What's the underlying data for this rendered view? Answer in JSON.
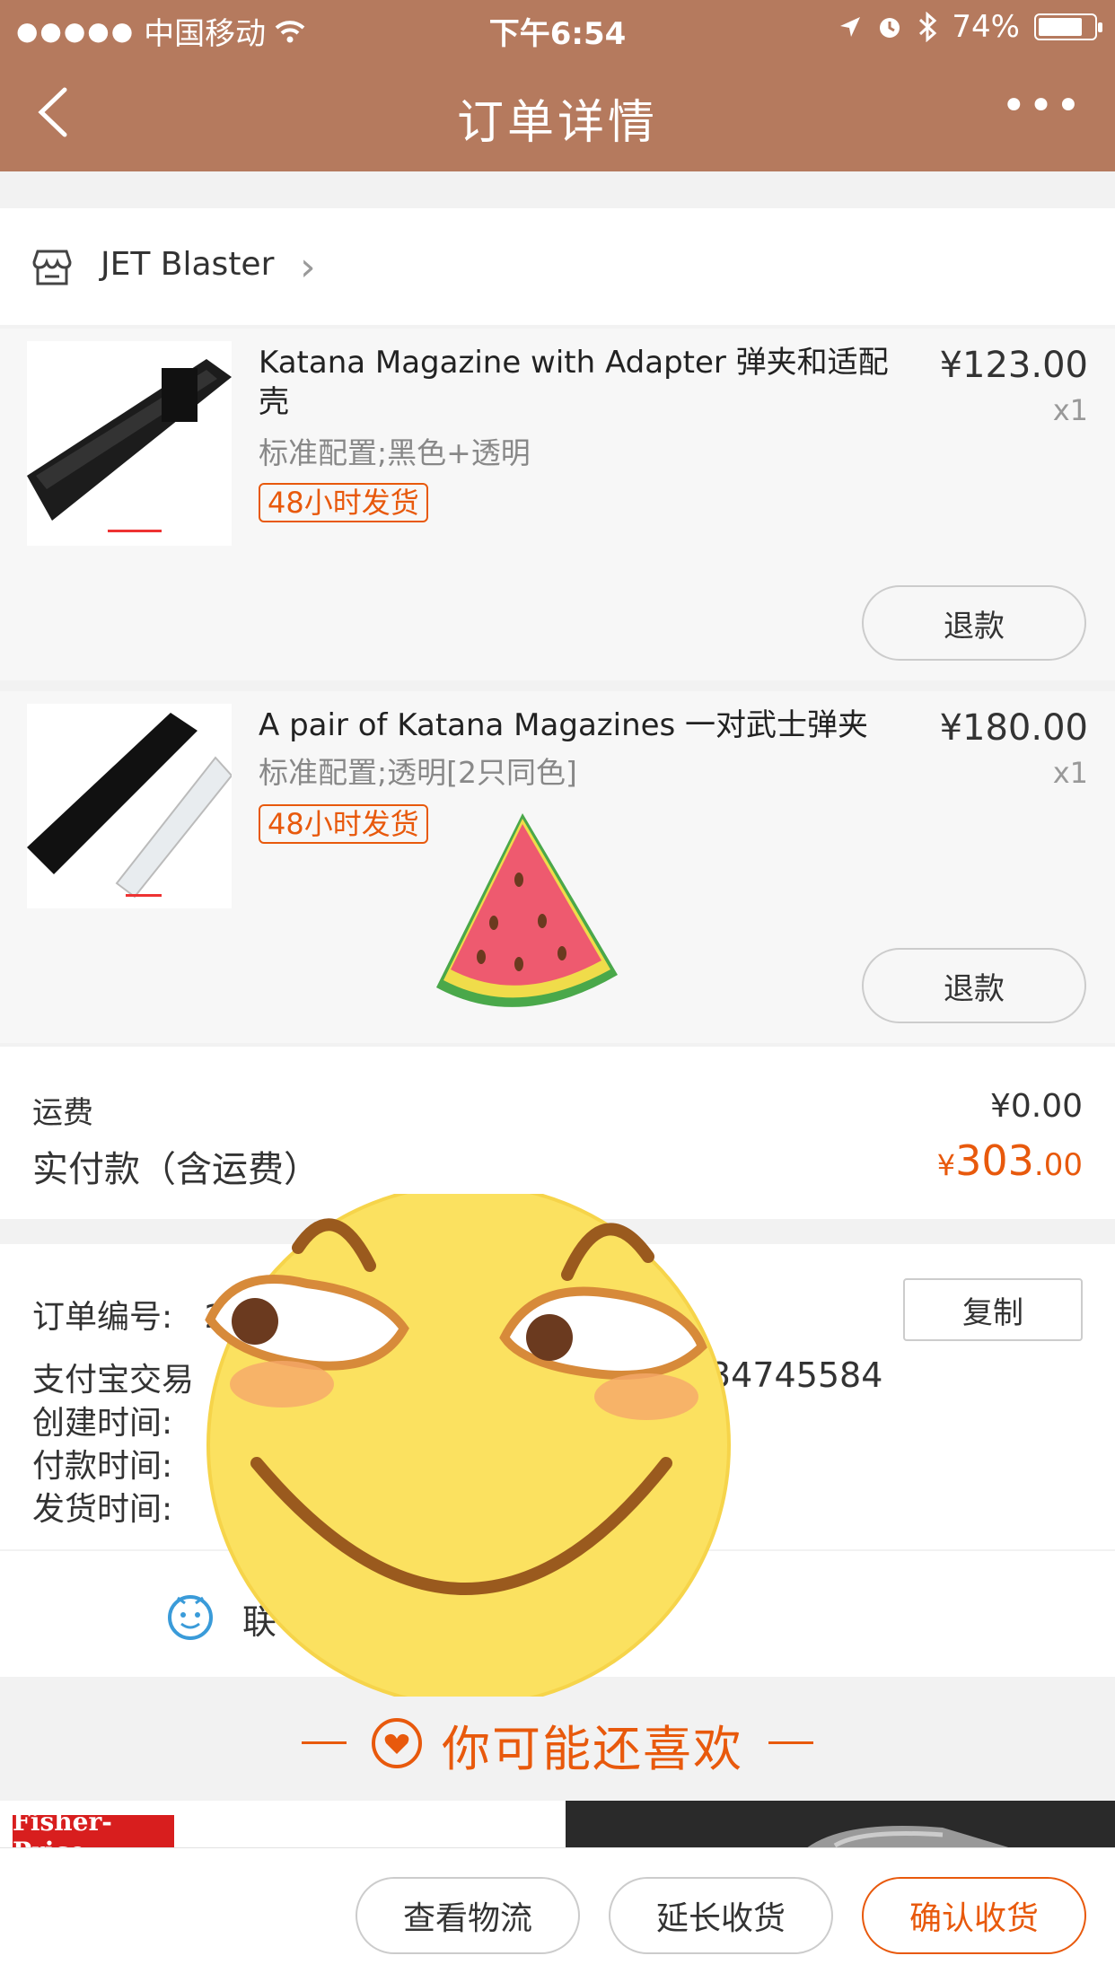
{
  "status_bar": {
    "carrier": "中国移动",
    "time": "下午6:54",
    "battery": "74%",
    "battery_level": 0.74
  },
  "nav": {
    "title": "订单详情",
    "back_icon": "chevron-left-icon",
    "more_icon": "more-dots-icon"
  },
  "shop": {
    "name": "JET Blaster"
  },
  "items": [
    {
      "title": "Katana Magazine with Adapter  弹夹和适配壳",
      "spec": "标准配置;黑色+透明",
      "badge": "48小时发货",
      "price": "¥123.00",
      "qty": "x1",
      "refund": "退款"
    },
    {
      "title": "A pair of Katana Magazines     一对武士弹夹",
      "spec": "标准配置;透明[2只同色]",
      "badge": "48小时发货",
      "price": "¥180.00",
      "qty": "x1",
      "refund": "退款"
    }
  ],
  "fees": {
    "shipping_label": "运费",
    "shipping_value": "¥0.00",
    "total_label": "实付款（含运费）",
    "total_currency": "¥",
    "total_int": "303",
    "total_dec": ".00"
  },
  "order_info": {
    "order_no_label": "订单编号:",
    "order_no_visible": "2",
    "alipay_label": "支付宝交易",
    "alipay_tail": "34745584",
    "created_label": "创建时间:",
    "paid_label": "付款时间:",
    "shipped_label": "发货时间:",
    "copy_label": "复制"
  },
  "contact": {
    "label_visible": "联"
  },
  "recommend": {
    "label": "你可能还喜欢"
  },
  "products": {
    "brand_logo": "Fisher-Price"
  },
  "bottom_bar": {
    "logistics": "查看物流",
    "extend": "延长收货",
    "confirm": "确认收货"
  },
  "colors": {
    "header": "#b57a5e",
    "accent": "#e8590c"
  }
}
